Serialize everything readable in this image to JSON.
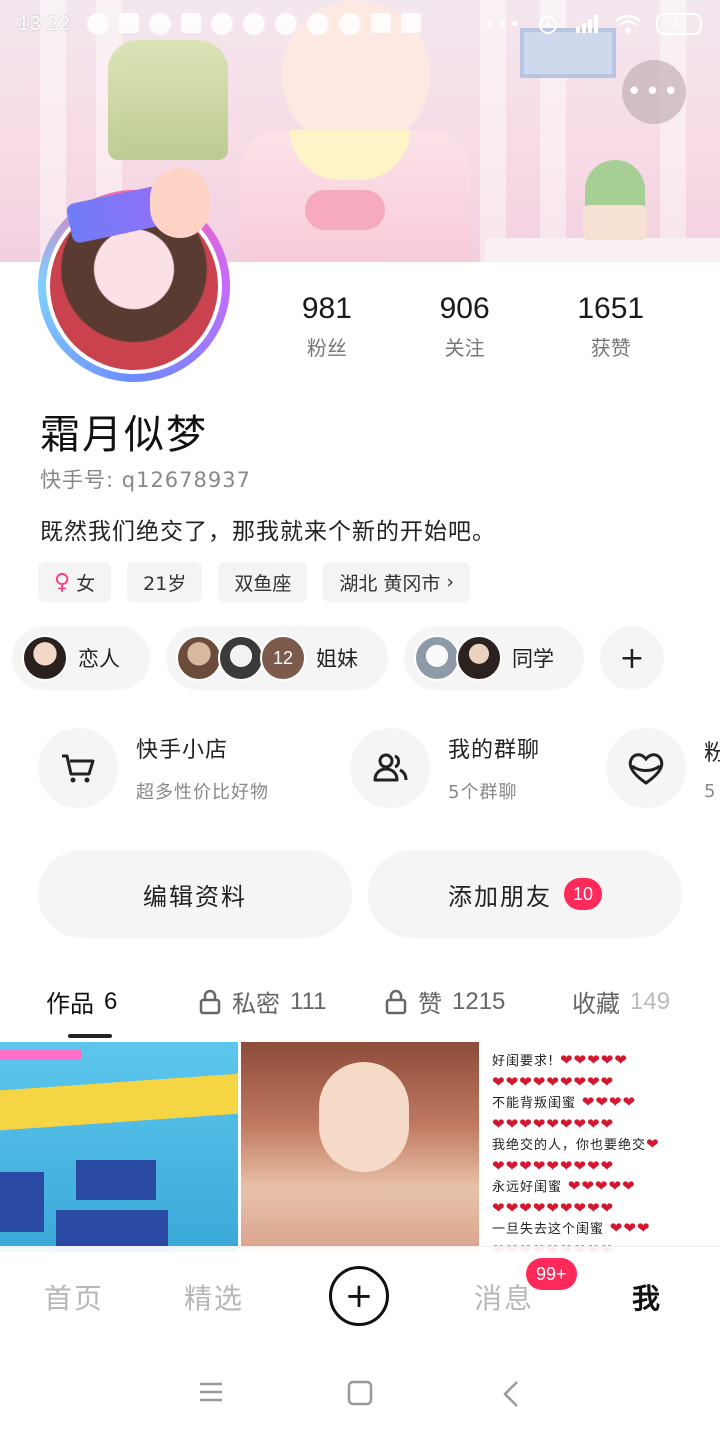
{
  "status_bar": {
    "time": "13:22",
    "battery": "43",
    "more_dots": "•••"
  },
  "header": {
    "more_label": "•••"
  },
  "profile": {
    "name": "霜月似梦",
    "kuaishou_id": "快手号: q12678937",
    "bio": "既然我们绝交了，那我就来个新的开始吧。",
    "stats": [
      {
        "value": "981",
        "label": "粉丝"
      },
      {
        "value": "906",
        "label": "关注"
      },
      {
        "value": "1651",
        "label": "获赞"
      }
    ],
    "tags": {
      "gender_symbol": "♀",
      "gender": "女",
      "age": "21岁",
      "zodiac": "双鱼座",
      "location": "湖北 黄冈市",
      "location_arrow": "›"
    }
  },
  "relations": {
    "lover": "恋人",
    "sisters_count": "12",
    "sisters": "姐妹",
    "classmates": "同学",
    "add": "+"
  },
  "features": [
    {
      "title": "快手小店",
      "subtitle": "超多性价比好物",
      "icon": "cart-icon"
    },
    {
      "title": "我的群聊",
      "subtitle": "5个群聊",
      "icon": "group-icon"
    },
    {
      "title": "粉",
      "subtitle": "5",
      "icon": "heart-icon"
    }
  ],
  "buttons": {
    "edit_profile": "编辑资料",
    "add_friend": "添加朋友",
    "add_friend_badge": "10"
  },
  "tabs": [
    {
      "label": "作品",
      "count": "6",
      "locked": false,
      "active": true
    },
    {
      "label": "私密",
      "count": "111",
      "locked": true,
      "active": false
    },
    {
      "label": "赞",
      "count": "1215",
      "locked": true,
      "active": false
    },
    {
      "label": "收藏",
      "count": "149",
      "locked": false,
      "active": false
    }
  ],
  "grid": {
    "text_cell": {
      "line1": "好闺要求!",
      "line2": "不能背叛闺蜜",
      "line3": "我绝交的人，你也要绝交",
      "line4": "永远好闺蜜",
      "line5": "一旦失去这个闺蜜"
    }
  },
  "bottom_nav": {
    "home": "首页",
    "featured": "精选",
    "plus": "+",
    "messages": "消息",
    "messages_badge": "99+",
    "me": "我"
  },
  "colors": {
    "accent_red": "#ff2a5a",
    "gender_pink": "#ff3e7e"
  }
}
